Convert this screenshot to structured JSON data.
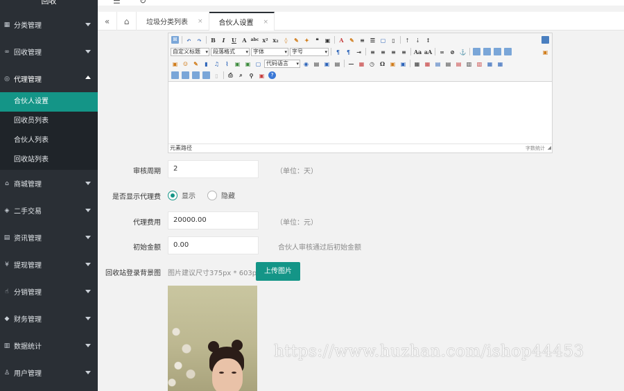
{
  "sidebar": {
    "logo": "回收",
    "groups": [
      {
        "label": "分类管理",
        "icon": "grid-icon"
      },
      {
        "label": "回收管理",
        "icon": "infinity-icon"
      },
      {
        "label": "代理管理",
        "icon": "target-icon"
      },
      {
        "label": "商城管理",
        "icon": "shop-icon"
      },
      {
        "label": "二手交易",
        "icon": "cube-icon"
      },
      {
        "label": "资讯管理",
        "icon": "document-icon"
      },
      {
        "label": "提现管理",
        "icon": "yen-icon"
      },
      {
        "label": "分销管理",
        "icon": "hand-icon"
      },
      {
        "label": "财务管理",
        "icon": "diamond-icon"
      },
      {
        "label": "数据统计",
        "icon": "chart-icon"
      },
      {
        "label": "用户管理",
        "icon": "user-icon"
      }
    ],
    "submenu": [
      "合伙人设置",
      "回收员列表",
      "合伙人列表",
      "回收站列表"
    ]
  },
  "tabs": {
    "list": [
      {
        "label": "垃圾分类列表",
        "close": "×"
      },
      {
        "label": "合伙人设置",
        "close": "×"
      }
    ]
  },
  "editor": {
    "combos": [
      "自定义标题",
      "段落格式",
      "字体",
      "字号",
      "代码语言"
    ],
    "status_left": "元素路径",
    "status_right": "字数统计"
  },
  "form": {
    "review_period": {
      "label": "审核周期",
      "value": "2",
      "hint": "（单位：天）"
    },
    "show_fee": {
      "label": "是否显示代理费",
      "opt_show": "显示",
      "opt_hide": "隐藏"
    },
    "agent_fee": {
      "label": "代理费用",
      "value": "20000.00",
      "hint": "（单位：元）"
    },
    "initial_amount": {
      "label": "初始金额",
      "value": "0.00",
      "hint": "合伙人审核通过后初始金额"
    },
    "bg_image": {
      "label": "回收站登录背景图",
      "hint": "图片建议尺寸375px * 603px",
      "button": "上传图片"
    }
  },
  "watermark": "https://www.huzhan.com/ishop44453",
  "colors": {
    "sidebar": "#2a2f35",
    "accent": "#149587"
  }
}
